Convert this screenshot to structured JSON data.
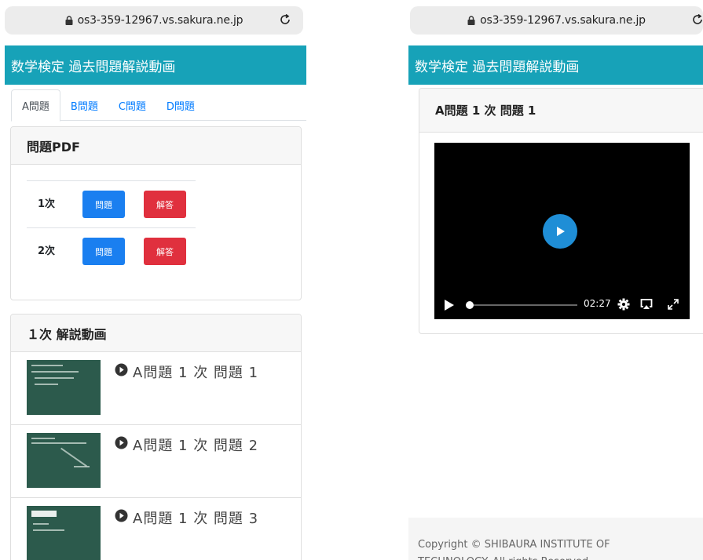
{
  "left_phone": {
    "url": "os3-359-12967.vs.sakura.ne.jp",
    "navbar_title": "数学検定 過去問題解説動画",
    "tabs": [
      {
        "label": "A問題",
        "active": true
      },
      {
        "label": "B問題",
        "active": false
      },
      {
        "label": "C問題",
        "active": false
      },
      {
        "label": "D問題",
        "active": false
      }
    ],
    "pdf_card": {
      "title": "問題PDF",
      "rows": [
        {
          "level": "1次",
          "question_label": "問題",
          "answer_label": "解答"
        },
        {
          "level": "2次",
          "question_label": "問題",
          "answer_label": "解答"
        }
      ]
    },
    "video_list": {
      "title": "１次 解説動画",
      "items": [
        {
          "title": "A問題 1 次 問題 1"
        },
        {
          "title": "A問題 1 次 問題 2"
        },
        {
          "title": "A問題 1 次 問題 3"
        }
      ]
    }
  },
  "right_phone": {
    "url": "os3-359-12967.vs.sakura.ne.jp",
    "navbar_title": "数学検定 過去問題解説動画",
    "player": {
      "title": "A問題 1 次 問題 1",
      "time": "02:27",
      "progress": 0.0
    },
    "footer_line1": "Copyright © SHIBAURA INSTITUTE OF",
    "footer_line2": "TECHNOLOGY. All rights Reserved."
  },
  "colors": {
    "navbar": "#17a2b8",
    "question_button": "#1a7ff0",
    "answer_button": "#e0303e",
    "play_button": "#1f8ed6",
    "link": "#007bff"
  },
  "icons": [
    "lock-icon",
    "reload-icon",
    "play-circle-icon",
    "play-icon",
    "gear-icon",
    "airplay-icon",
    "fullscreen-icon"
  ]
}
